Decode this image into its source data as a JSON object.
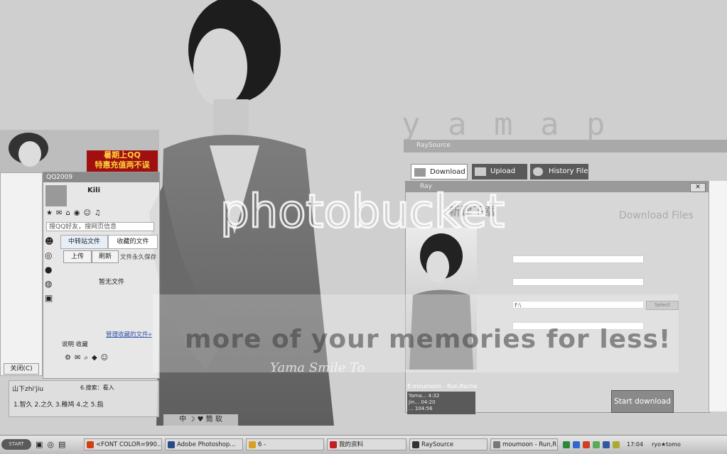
{
  "wallpaper": {
    "title_text": "y a m a p",
    "watermark_logo": "photobucket",
    "watermark_tagline": "more of your memories for less!",
    "signature_text": "Yama Smile To"
  },
  "qq": {
    "window_title": "QQ2009",
    "ad_line1": "暑期上QQ",
    "ad_line2": "特惠充值两不误",
    "search_placeholder": "搜QQ好友，搜网页信息",
    "tab_transfer": "中转站文件",
    "tab_favorites": "收藏的文件",
    "btn_upload": "上传",
    "btn_refresh": "刷新",
    "perm_label": "文件永久保存",
    "empty_label": "暂无文件",
    "manage_link": "管理收藏的文件»",
    "explain_label": "说明 收藏",
    "close_btn": "关闭(C)",
    "nickname": "Kili",
    "bottom_name": "山下zhi'jiu",
    "bottom_hint": "6.搜索：看入",
    "bottom_candidates": "1.智久  2.之久  3.稚鸠  4.之  5.指",
    "ime_label": "中 ☽ ♥ 筒 软"
  },
  "ray": {
    "brand": "RaySource",
    "tabs": [
      {
        "label": "Download"
      },
      {
        "label": "Upload"
      },
      {
        "label": "History File"
      }
    ],
    "inner_title": "Ray",
    "new_download_label": "新建下载",
    "download_files_label": "Download Files",
    "path_value": "F:\\",
    "select_btn": "Select",
    "start_btn": "Start download",
    "now_playing": "8.moumoon - Run,Rache",
    "player_line1": "Yama...  4:32",
    "player_line2": "Jin...  04:20",
    "player_line3": "...  104:56"
  },
  "taskbar": {
    "start": "START",
    "items": [
      {
        "label": "<FONT COLOR=990...",
        "color": "#d04010"
      },
      {
        "label": "Adobe Photoshop...",
        "color": "#2a4a8a"
      },
      {
        "label": "6 -",
        "color": "#d8a020"
      },
      {
        "label": "我的资料",
        "color": "#c02020"
      },
      {
        "label": "RaySource",
        "color": "#333333"
      },
      {
        "label": "moumoon - Run,R...",
        "color": "#777777"
      }
    ],
    "clock": "17:04",
    "user": "ryo★tomo"
  }
}
